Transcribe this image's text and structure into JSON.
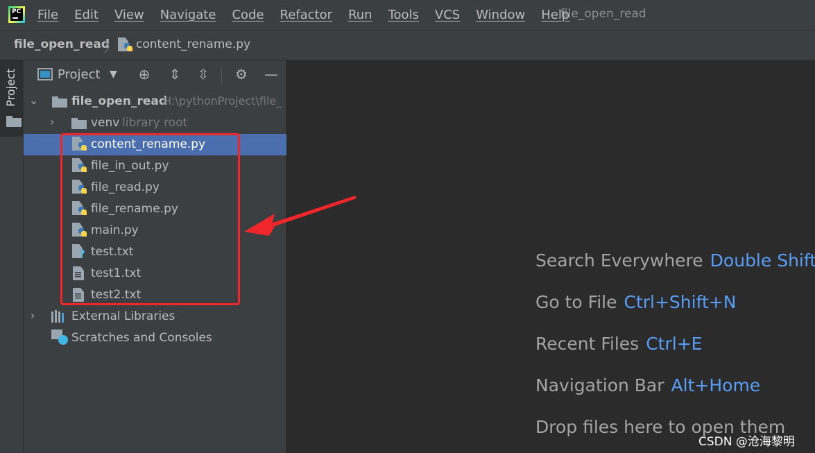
{
  "menubar": {
    "items": [
      "File",
      "Edit",
      "View",
      "Navigate",
      "Code",
      "Refactor",
      "Run",
      "Tools",
      "VCS",
      "Window",
      "Help"
    ],
    "window_title": "file_open_read"
  },
  "navbar": {
    "project": "file_open_read",
    "file": "content_rename.py"
  },
  "left_stripe": {
    "tab_label": "Project"
  },
  "project_panel": {
    "view_label": "Project",
    "root": {
      "name": "file_open_read",
      "path": "H:\\pythonProject\\file_"
    },
    "venv": {
      "name": "venv",
      "hint": "library root"
    },
    "files": [
      {
        "name": "content_rename.py",
        "kind": "python",
        "selected": true
      },
      {
        "name": "file_in_out.py",
        "kind": "python"
      },
      {
        "name": "file_read.py",
        "kind": "python"
      },
      {
        "name": "file_rename.py",
        "kind": "python"
      },
      {
        "name": "main.py",
        "kind": "python"
      },
      {
        "name": "test.txt",
        "kind": "unknown"
      },
      {
        "name": "test1.txt",
        "kind": "text"
      },
      {
        "name": "test2.txt",
        "kind": "text"
      }
    ],
    "external_libraries": "External Libraries",
    "scratches": "Scratches and Consoles"
  },
  "editor_hints": [
    {
      "label": "Search Everywhere",
      "key": "Double Shift"
    },
    {
      "label": "Go to File",
      "key": "Ctrl+Shift+N"
    },
    {
      "label": "Recent Files",
      "key": "Ctrl+E"
    },
    {
      "label": "Navigation Bar",
      "key": "Alt+Home"
    },
    {
      "label": "Drop files here to open them",
      "key": ""
    }
  ],
  "watermark": "CSDN @沧海黎明",
  "colors": {
    "selection": "#4b6eaf",
    "accent_key": "#589df6",
    "annotation_red": "#f0262a"
  }
}
